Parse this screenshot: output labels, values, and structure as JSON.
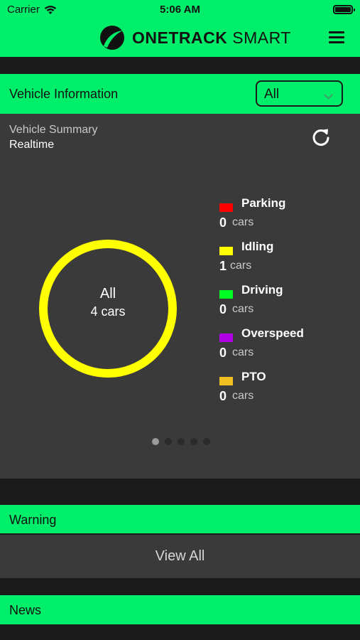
{
  "status_bar": {
    "carrier": "Carrier",
    "time": "5:06 AM"
  },
  "header": {
    "brand_bold": "ONETRACK",
    "brand_light": " SMART",
    "menu_icon": "hamburger-menu-icon"
  },
  "vehicle_info": {
    "title": "Vehicle Information",
    "filter": {
      "selected": "All",
      "icon": "chevron-down-icon"
    }
  },
  "summary": {
    "title": "Vehicle Summary",
    "subtitle": "Realtime",
    "refresh_icon": "refresh-icon",
    "donut": {
      "label": "All",
      "total": "4 cars",
      "ring_color": "#ffff00"
    },
    "legend": [
      {
        "name": "Parking",
        "count": "0",
        "unit": "cars",
        "color": "#ff0000"
      },
      {
        "name": "Idling",
        "count": "1",
        "unit": "cars",
        "color": "#ffff00"
      },
      {
        "name": "Driving",
        "count": "0",
        "unit": "cars",
        "color": "#00ff22"
      },
      {
        "name": "Overspeed",
        "count": "0",
        "unit": "cars",
        "color": "#b200e6"
      },
      {
        "name": "PTO",
        "count": "0",
        "unit": "cars",
        "color": "#f0c020"
      }
    ],
    "pager": {
      "pages": 5,
      "active": 1
    }
  },
  "warning": {
    "title": "Warning",
    "view_all": "View All"
  },
  "news": {
    "title": "News"
  },
  "colors": {
    "accent": "#00ef6a",
    "panel": "#3a3a3a",
    "background": "#1a1a1a"
  }
}
